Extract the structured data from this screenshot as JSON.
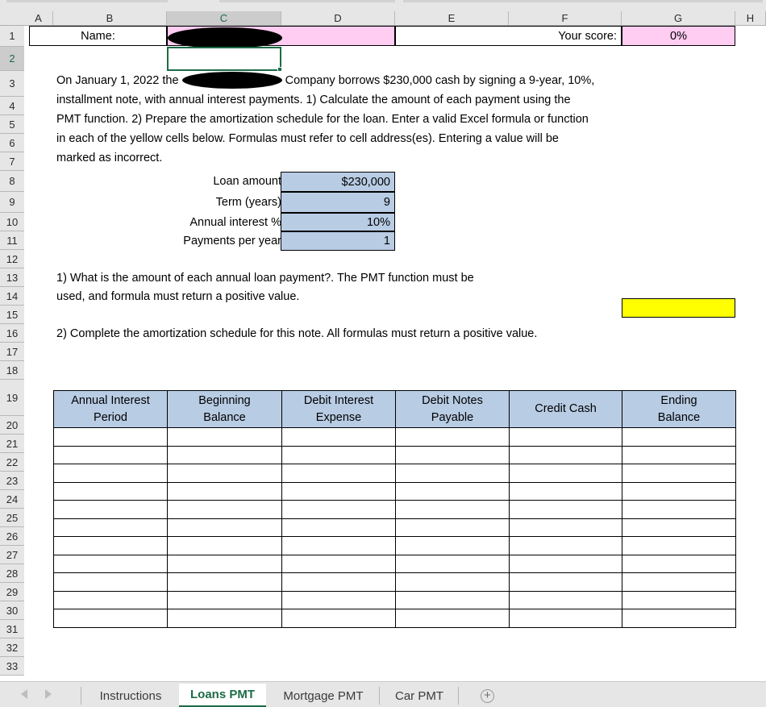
{
  "app": {
    "type": "spreadsheet",
    "column_headers": [
      "A",
      "B",
      "C",
      "D",
      "E",
      "F",
      "G",
      "H"
    ],
    "selected_column": "C",
    "active_cell": "C2",
    "selected_row": "2",
    "row_headers": [
      "1",
      "2",
      "3",
      "4",
      "5",
      "6",
      "7",
      "8",
      "9",
      "10",
      "11",
      "12",
      "13",
      "14",
      "15",
      "16",
      "17",
      "18",
      "19",
      "20",
      "21",
      "22",
      "23",
      "24",
      "25",
      "26",
      "27",
      "28",
      "29",
      "30",
      "31",
      "32",
      "33"
    ]
  },
  "header_row": {
    "name_label": "Name:",
    "name_value": "",
    "score_label": "Your score:",
    "score_value": "0%"
  },
  "instructions": {
    "paragraph": "On January 1, 2022 the                    Company borrows $230,000 cash by signing a 9-year, 10%, installment note, with annual interest payments.  1)  Calculate the amount of each payment using the PMT function.  2)  Prepare the amortization schedule for the loan.  Enter a valid Excel formula or function in each of the yellow cells below.  Formulas must refer to cell address(es).  Entering a value will be marked as incorrect.",
    "line1_pre": "On January 1, 2022 the",
    "line1_post": "Company borrows $230,000 cash by signing a 9-year, 10%,",
    "line2": "installment note, with annual interest payments.  1)  Calculate the amount of each payment using the",
    "line3": "PMT function.  2)  Prepare the amortization schedule for the loan.  Enter a valid Excel formula or function",
    "line4": "in each of the yellow cells below.  Formulas must refer to cell address(es).  Entering a value will be",
    "line5": "marked as incorrect."
  },
  "loan_inputs": {
    "rows": [
      {
        "label": "Loan amount",
        "value": "$230,000"
      },
      {
        "label": "Term (years)",
        "value": "9"
      },
      {
        "label": "Annual interest %",
        "value": "10%"
      },
      {
        "label": "Payments per year",
        "value": "1"
      }
    ]
  },
  "question1": {
    "line1": "1)  What is the amount of each annual loan payment?.  The PMT function must be",
    "line2": "used, and formula must return a positive value.",
    "answer_value": ""
  },
  "question2": {
    "line1": "2)  Complete the amortization schedule for this note.  All formulas must return a positive value."
  },
  "amortization": {
    "columns": [
      {
        "line1": "Annual Interest",
        "line2": "Period"
      },
      {
        "line1": "Beginning",
        "line2": "Balance"
      },
      {
        "line1": "Debit Interest",
        "line2": "Expense"
      },
      {
        "line1": "Debit Notes",
        "line2": "Payable"
      },
      {
        "line1": "Credit Cash",
        "line2": ""
      },
      {
        "line1": "Ending",
        "line2": "Balance"
      }
    ],
    "rows": [
      [
        "",
        "",
        "",
        "",
        "",
        ""
      ],
      [
        "",
        "",
        "",
        "",
        "",
        ""
      ],
      [
        "",
        "",
        "",
        "",
        "",
        ""
      ],
      [
        "",
        "",
        "",
        "",
        "",
        ""
      ],
      [
        "",
        "",
        "",
        "",
        "",
        ""
      ],
      [
        "",
        "",
        "",
        "",
        "",
        ""
      ],
      [
        "",
        "",
        "",
        "",
        "",
        ""
      ],
      [
        "",
        "",
        "",
        "",
        "",
        ""
      ],
      [
        "",
        "",
        "",
        "",
        "",
        ""
      ],
      [
        "",
        "",
        "",
        "",
        "",
        ""
      ],
      [
        "",
        "",
        "",
        "",
        "",
        ""
      ]
    ]
  },
  "sheet_tabs": {
    "tabs": [
      {
        "label": "Instructions",
        "active": false
      },
      {
        "label": "Loans PMT",
        "active": true
      },
      {
        "label": "Mortgage PMT",
        "active": false
      },
      {
        "label": "Car PMT",
        "active": false
      }
    ],
    "add_sheet_label": "+",
    "nav_prev": "previous-sheet",
    "nav_next": "next-sheet"
  },
  "colors": {
    "input_blue": "#b8cce4",
    "answer_yellow": "#ffff00",
    "name_pink": "#ffccf2",
    "tab_active_green": "#1c6b47",
    "header_grey": "#e6e6e6"
  }
}
